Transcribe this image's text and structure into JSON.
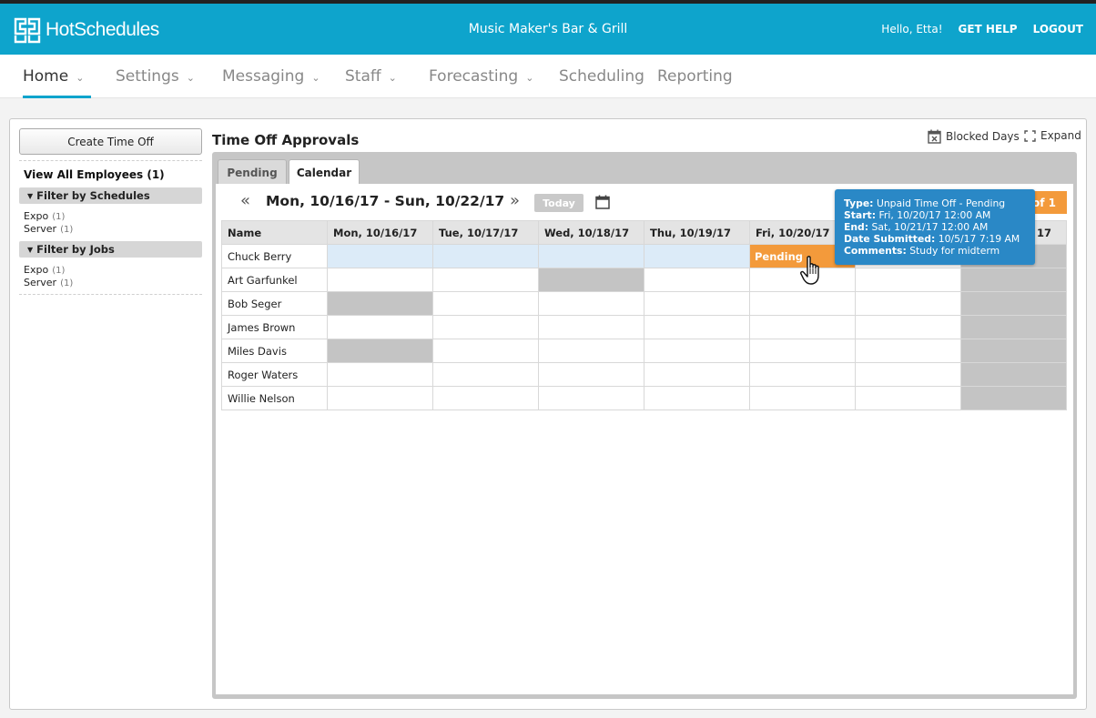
{
  "header": {
    "logo_text": "HotSchedules",
    "venue": "Music Maker's Bar & Grill",
    "greeting": "Hello, Etta!",
    "get_help": "GET HELP",
    "logout": "LOGOUT",
    "brand_color": "#0ea4cc"
  },
  "nav": {
    "items": [
      {
        "label": "Home"
      },
      {
        "label": "Settings"
      },
      {
        "label": "Messaging"
      },
      {
        "label": "Staff"
      },
      {
        "label": "Forecasting"
      },
      {
        "label": "Scheduling"
      },
      {
        "label": "Reporting"
      }
    ],
    "active": "Home"
  },
  "sidebar": {
    "create_button": "Create Time Off",
    "view_all": "View All Employees (1)",
    "schedules_header": "Filter by Schedules",
    "schedules": [
      {
        "label": "Expo",
        "count": "(1)"
      },
      {
        "label": "Server",
        "count": "(1)"
      }
    ],
    "jobs_header": "Filter by Jobs",
    "jobs": [
      {
        "label": "Expo",
        "count": "(1)"
      },
      {
        "label": "Server",
        "count": "(1)"
      }
    ]
  },
  "main": {
    "title": "Time Off Approvals",
    "blocked_days": "Blocked Days",
    "expand": "Expand",
    "tabs": [
      {
        "label": "Pending"
      },
      {
        "label": "Calendar"
      }
    ],
    "active_tab": "Calendar",
    "date_range": "Mon, 10/16/17 - Sun, 10/22/17",
    "today": "Today",
    "pager": "of 1",
    "table": {
      "columns": [
        "Name",
        "Mon, 10/16/17",
        "Tue, 10/17/17",
        "Wed, 10/18/17",
        "Thu, 10/19/17",
        "Fri, 10/20/17",
        "",
        "17"
      ],
      "rows": [
        {
          "name": "Chuck Berry",
          "cells": [
            "blue",
            "blue",
            "blue",
            "blue",
            "pending",
            "",
            "blocked"
          ]
        },
        {
          "name": "Art Garfunkel",
          "cells": [
            "",
            "",
            "blocked",
            "",
            "",
            "",
            "blocked"
          ]
        },
        {
          "name": "Bob Seger",
          "cells": [
            "blocked",
            "",
            "",
            "",
            "",
            "",
            "blocked"
          ]
        },
        {
          "name": "James Brown",
          "cells": [
            "",
            "",
            "",
            "",
            "",
            "",
            "blocked"
          ]
        },
        {
          "name": "Miles Davis",
          "cells": [
            "blocked",
            "",
            "",
            "",
            "",
            "",
            "blocked"
          ]
        },
        {
          "name": "Roger Waters",
          "cells": [
            "",
            "",
            "",
            "",
            "",
            "",
            "blocked"
          ]
        },
        {
          "name": "Willie Nelson",
          "cells": [
            "",
            "",
            "",
            "",
            "",
            "",
            "blocked"
          ]
        }
      ],
      "pending_label": "Pending"
    },
    "tooltip": {
      "type_label": "Type:",
      "type_value": "Unpaid Time Off - Pending",
      "start_label": "Start:",
      "start_value": "Fri, 10/20/17 12:00 AM",
      "end_label": "End:",
      "end_value": "Sat, 10/21/17 12:00 AM",
      "submitted_label": "Date Submitted:",
      "submitted_value": "10/5/17 7:19 AM",
      "comments_label": "Comments:",
      "comments_value": "Study for midterm"
    }
  }
}
